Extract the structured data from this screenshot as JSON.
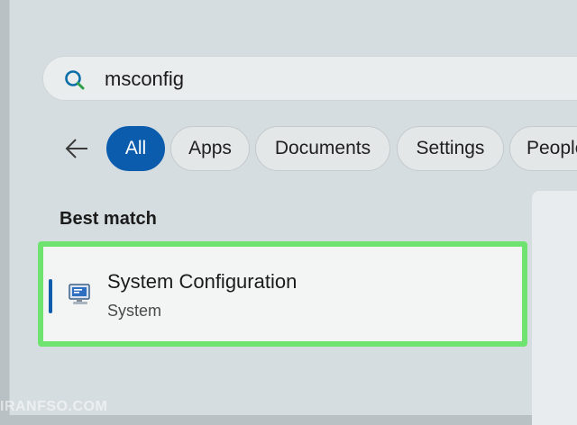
{
  "search": {
    "query": "msconfig"
  },
  "filters": {
    "chips": [
      {
        "label": "All",
        "active": true
      },
      {
        "label": "Apps",
        "active": false
      },
      {
        "label": "Documents",
        "active": false
      },
      {
        "label": "Settings",
        "active": false
      },
      {
        "label": "People",
        "active": false
      }
    ]
  },
  "results": {
    "section_title": "Best match",
    "best_match": {
      "title": "System Configuration",
      "subtitle": "System"
    }
  },
  "icons": {
    "search": "search-icon",
    "back": "back-arrow-icon",
    "app": "system-configuration-icon"
  },
  "colors": {
    "accent": "#0b5cad",
    "highlight": "#6fe36f"
  },
  "watermark": "IRANFSO.COM"
}
